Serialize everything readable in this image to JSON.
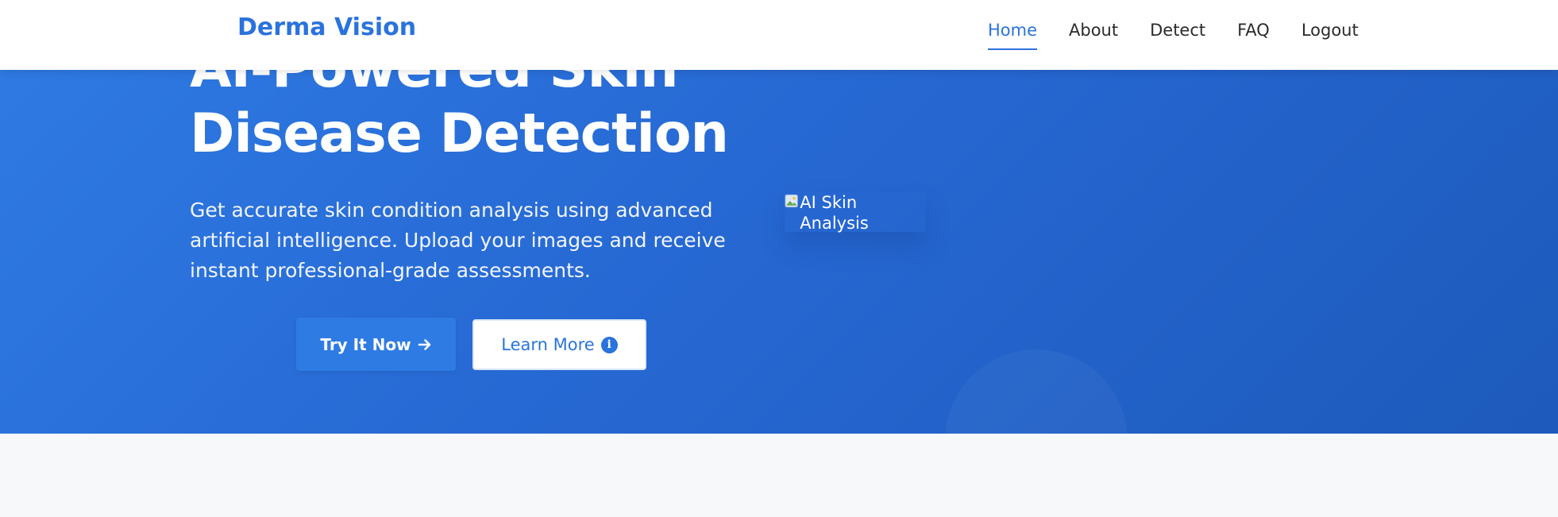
{
  "brand": {
    "name": "Derma Vision"
  },
  "nav": {
    "items": [
      {
        "label": "Home",
        "active": true
      },
      {
        "label": "About",
        "active": false
      },
      {
        "label": "Detect",
        "active": false
      },
      {
        "label": "FAQ",
        "active": false
      },
      {
        "label": "Logout",
        "active": false
      }
    ]
  },
  "hero": {
    "title_line1": "AI-Powered Skin",
    "title_line2": "Disease Detection",
    "subtitle": "Get accurate skin condition analysis using advanced artificial intelligence. Upload your images and receive instant professional-grade assessments.",
    "primary_button": {
      "label": "Try It Now",
      "icon": "arrow-right-icon"
    },
    "secondary_button": {
      "label": "Learn More",
      "icon": "info-circle-icon"
    },
    "image_alt": "AI Skin Analysis"
  },
  "colors": {
    "accent": "#2a73dd",
    "hero_gradient_start": "#2f7be4",
    "hero_gradient_end": "#1d5abb",
    "background": "#f7f8fa"
  }
}
